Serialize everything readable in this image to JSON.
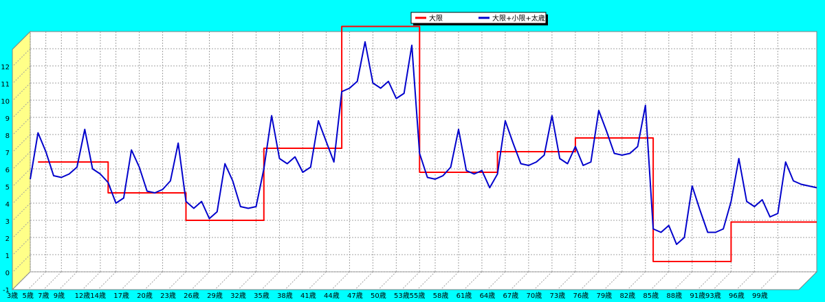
{
  "chart_data": {
    "type": "line",
    "y_ticks": [
      "-1",
      "0",
      "1",
      "2",
      "3",
      "4",
      "5",
      "6",
      "7",
      "8",
      "9",
      "10",
      "11",
      "12"
    ],
    "ylim": [
      -1,
      13
    ],
    "x_tick_labels": [
      "3歳",
      "5歳",
      "7歳",
      "9歳",
      "12歳",
      "14歳",
      "17歳",
      "20歳",
      "23歳",
      "26歳",
      "29歳",
      "32歳",
      "35歳",
      "38歳",
      "41歳",
      "44歳",
      "47歳",
      "50歳",
      "53歳",
      "55歳",
      "58歳",
      "61歳",
      "64歳",
      "67歳",
      "70歳",
      "73歳",
      "76歳",
      "79歳",
      "82歳",
      "85歳",
      "88歳",
      "91歳",
      "93歳",
      "96歳",
      "99歳"
    ],
    "x_tick_ages": [
      3,
      5,
      7,
      9,
      12,
      14,
      17,
      20,
      23,
      26,
      29,
      32,
      35,
      38,
      41,
      44,
      47,
      50,
      53,
      55,
      58,
      61,
      64,
      67,
      70,
      73,
      76,
      79,
      82,
      85,
      88,
      91,
      93,
      96,
      99
    ],
    "x_range": [
      3,
      104
    ],
    "grid": true,
    "legend": "top-center",
    "series": [
      {
        "name": "大限",
        "color": "#ff0000",
        "ages": [
          4,
          13,
          13,
          23,
          23,
          33,
          33,
          43,
          43,
          53,
          53,
          63,
          63,
          73,
          73,
          83,
          83,
          93,
          93,
          104
        ],
        "values": [
          5.4,
          5.4,
          3.6,
          3.6,
          2.0,
          2.0,
          6.2,
          6.2,
          13.3,
          13.3,
          4.8,
          4.8,
          6.0,
          6.0,
          6.8,
          6.8,
          -0.4,
          -0.4,
          1.9,
          1.9
        ]
      },
      {
        "name": "大限+小限+太歳",
        "color": "#0000cc",
        "ages": [
          3,
          4,
          5,
          6,
          7,
          8,
          9,
          10,
          11,
          12,
          13,
          14,
          15,
          16,
          17,
          18,
          19,
          20,
          21,
          22,
          23,
          24,
          25,
          26,
          27,
          28,
          29,
          30,
          31,
          32,
          33,
          34,
          35,
          36,
          37,
          38,
          39,
          40,
          41,
          42,
          43,
          44,
          45,
          46,
          47,
          48,
          49,
          50,
          51,
          52,
          53,
          54,
          55,
          56,
          57,
          58,
          59,
          60,
          61,
          62,
          63,
          64,
          65,
          66,
          67,
          68,
          69,
          70,
          71,
          72,
          73,
          74,
          75,
          76,
          77,
          78,
          79,
          80,
          81,
          82,
          83,
          84,
          85,
          86,
          87,
          88,
          89,
          90,
          91,
          92,
          93,
          94,
          95,
          96,
          97,
          98,
          99,
          100,
          101,
          102,
          103,
          104
        ],
        "values": [
          4.4,
          7.1,
          6.0,
          4.6,
          4.5,
          4.7,
          5.1,
          7.3,
          5.0,
          4.7,
          4.2,
          3.0,
          3.3,
          6.1,
          5.1,
          3.7,
          3.6,
          3.8,
          4.3,
          6.5,
          3.1,
          2.7,
          3.1,
          2.1,
          2.5,
          5.3,
          4.3,
          2.8,
          2.7,
          2.8,
          5.0,
          8.1,
          5.6,
          5.3,
          5.7,
          4.8,
          5.1,
          7.8,
          6.6,
          5.4,
          9.5,
          9.7,
          10.1,
          12.4,
          10.0,
          9.7,
          10.1,
          9.1,
          9.4,
          12.2,
          5.9,
          4.5,
          4.4,
          4.6,
          5.1,
          7.3,
          4.9,
          4.7,
          4.9,
          3.9,
          4.7,
          7.8,
          6.5,
          5.3,
          5.2,
          5.4,
          5.8,
          8.1,
          5.6,
          5.3,
          6.3,
          5.2,
          5.4,
          8.4,
          7.2,
          5.9,
          5.8,
          5.9,
          6.3,
          8.7,
          1.5,
          1.3,
          1.7,
          0.6,
          1.0,
          4.0,
          2.6,
          1.3,
          1.3,
          1.5,
          3.1,
          5.6,
          3.1,
          2.8,
          3.2,
          2.2,
          2.4,
          5.4,
          4.3,
          4.1,
          4.0,
          3.9
        ]
      }
    ]
  }
}
